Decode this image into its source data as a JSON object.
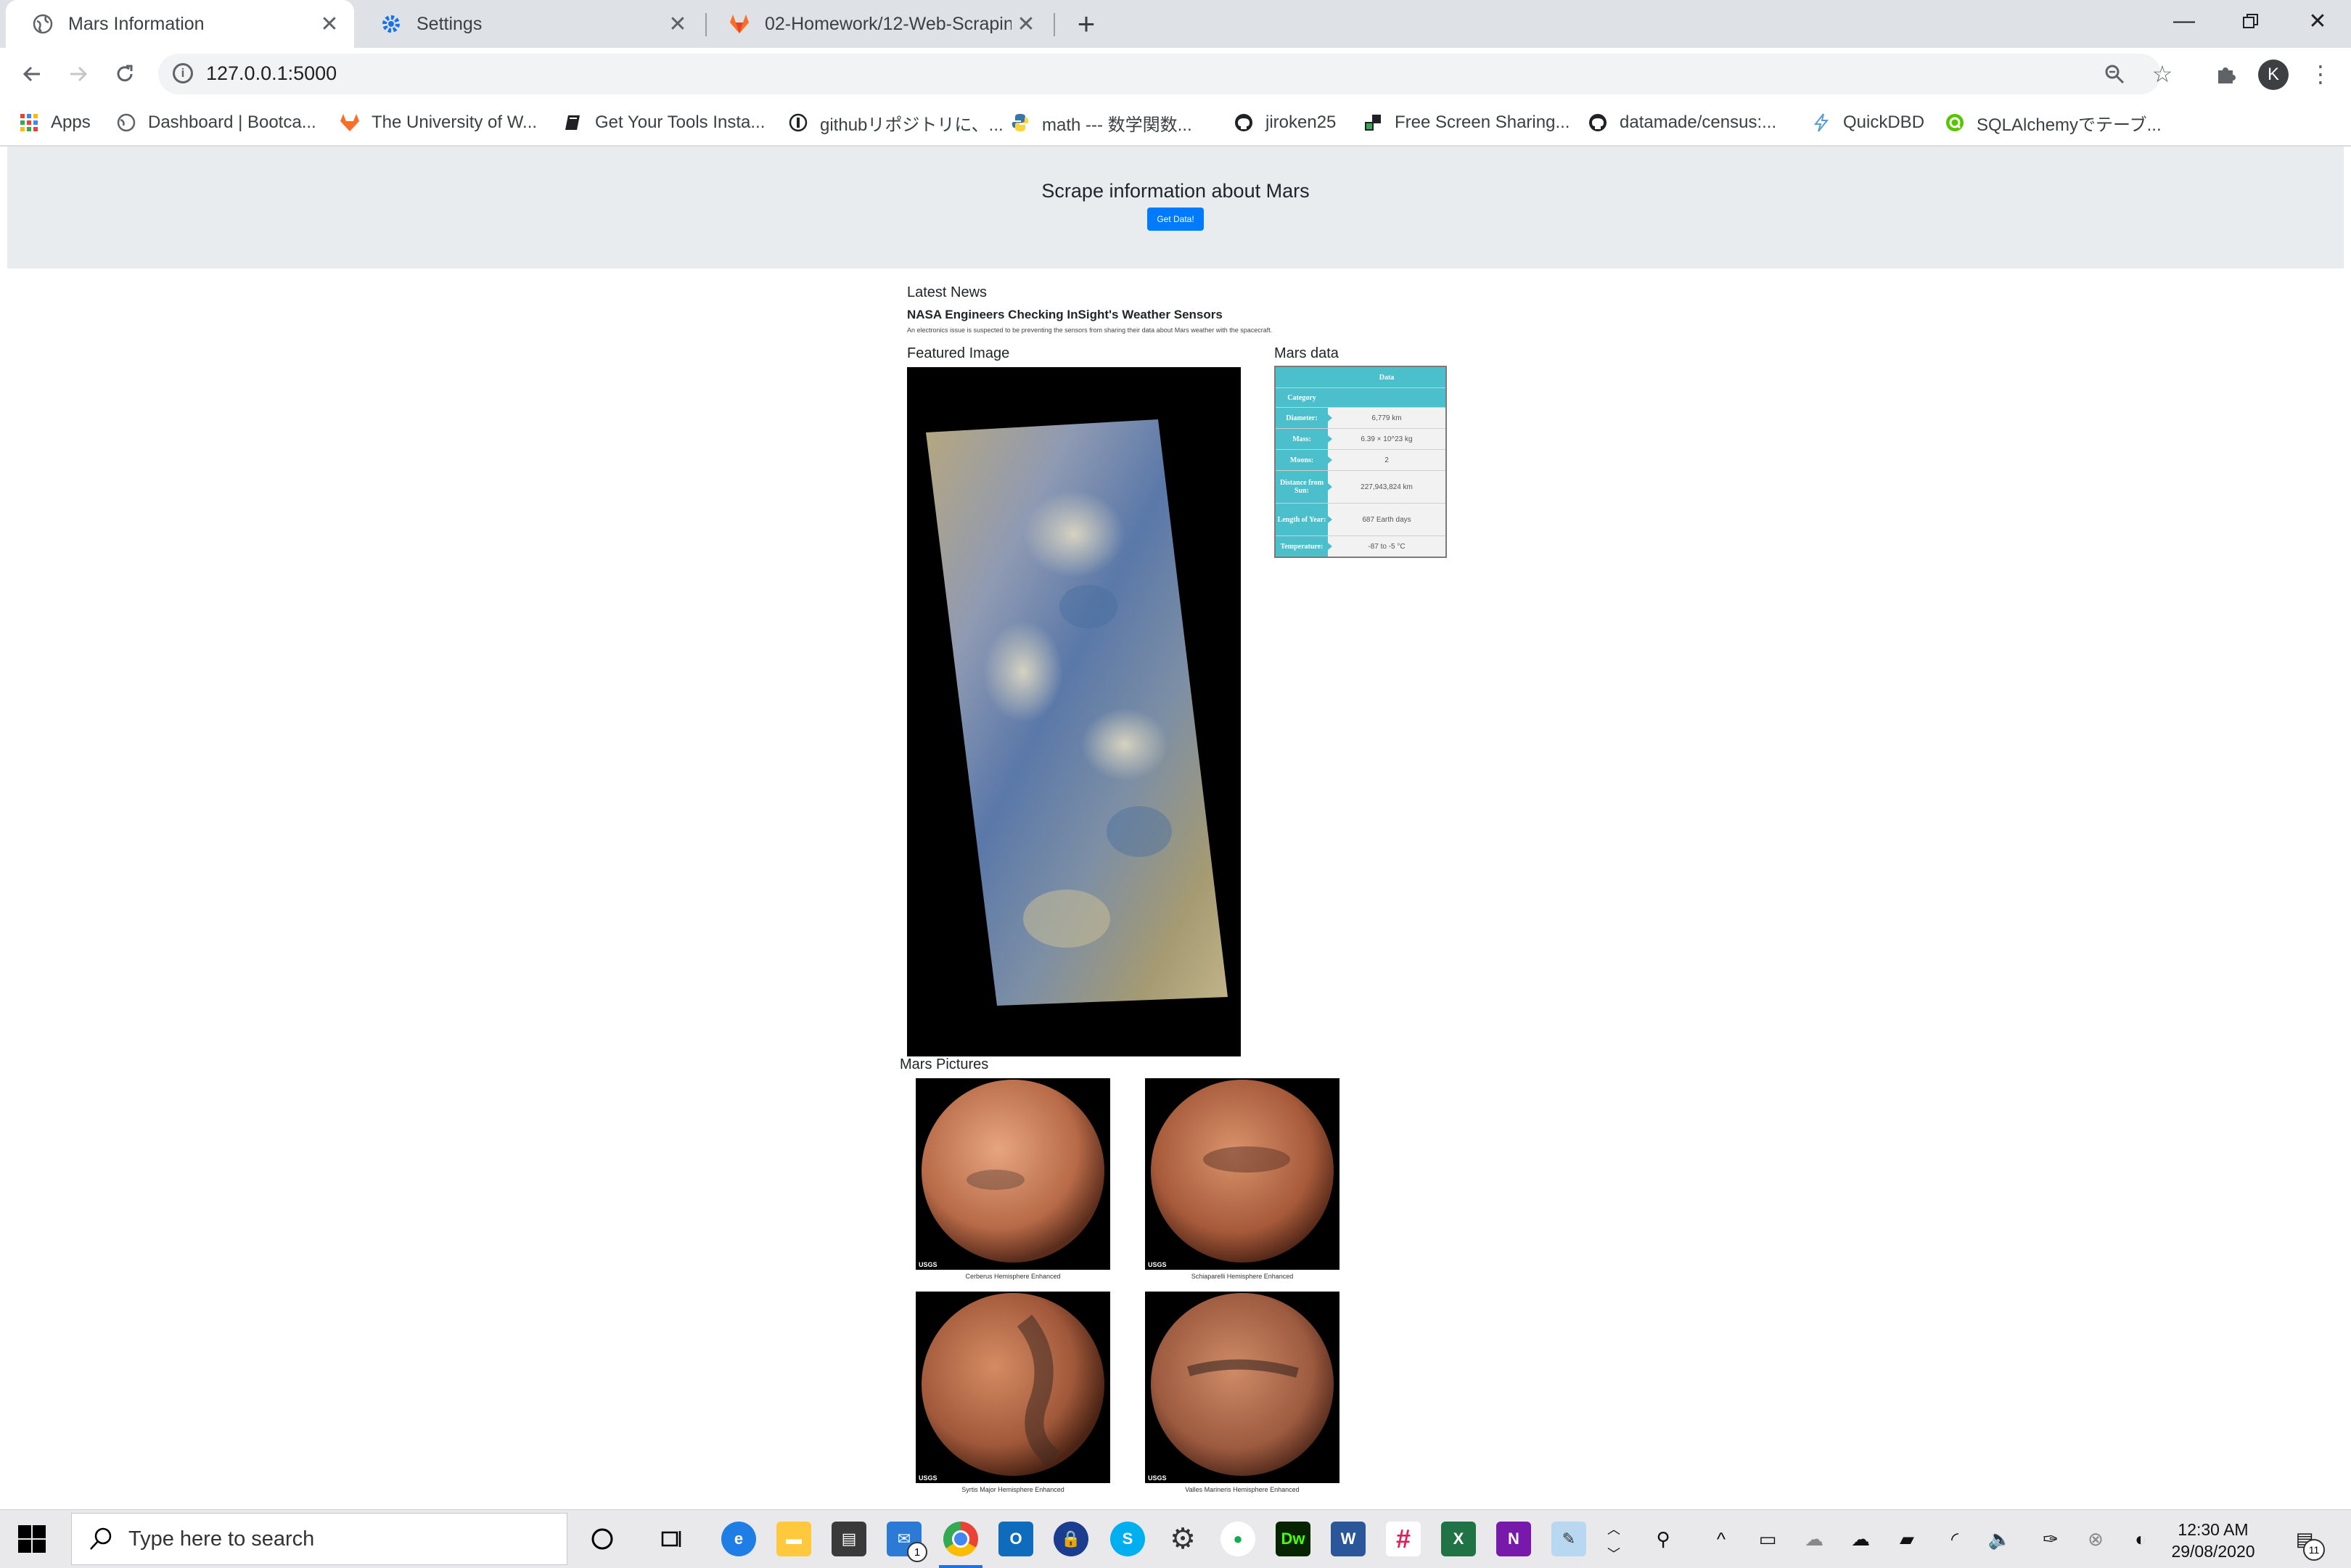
{
  "browser": {
    "tabs": [
      {
        "title": "Mars Information",
        "active": true
      },
      {
        "title": "Settings",
        "active": false
      },
      {
        "title": "02-Homework/12-Web-Scraping",
        "active": false
      }
    ],
    "url": "127.0.0.1:5000",
    "profile_initial": "K",
    "bookmarks": [
      {
        "label": "Apps",
        "icon": "apps-grid-icon"
      },
      {
        "label": "Dashboard | Bootca...",
        "icon": "globe-icon"
      },
      {
        "label": "The University of W...",
        "icon": "gitlab-icon"
      },
      {
        "label": "Get Your Tools Insta...",
        "icon": "book-icon"
      },
      {
        "label": "githubリポジトリに、...",
        "icon": "circle-icon"
      },
      {
        "label": "math --- 数学関数...",
        "icon": "python-icon"
      },
      {
        "label": "jiroken25",
        "icon": "github-icon"
      },
      {
        "label": "Free Screen Sharing...",
        "icon": "screenshare-icon"
      },
      {
        "label": "datamade/census:...",
        "icon": "github-icon"
      },
      {
        "label": "QuickDBD",
        "icon": "bolt-icon"
      },
      {
        "label": "SQLAlchemyでテーブ...",
        "icon": "qiita-icon"
      }
    ]
  },
  "page": {
    "jumbotron_title": "Scrape information about Mars",
    "get_data_label": "Get Data!",
    "latest_news_heading": "Latest News",
    "news_title": "NASA Engineers Checking InSight's Weather Sensors",
    "news_paragraph": "An electronics issue is suspected to be preventing the sensors from sharing their data about Mars weather with the spacecraft.",
    "featured_heading": "Featured Image",
    "facts_heading": "Mars data",
    "facts_header": {
      "key": "Category",
      "value": "Data"
    },
    "facts": [
      {
        "key": "Diameter:",
        "value": "6,779 km"
      },
      {
        "key": "Mass:",
        "value": "6.39 × 10^23 kg"
      },
      {
        "key": "Moons:",
        "value": "2"
      },
      {
        "key": "Distance from Sun:",
        "value": "227,943,824 km"
      },
      {
        "key": "Length of Year:",
        "value": "687 Earth days"
      },
      {
        "key": "Temperature:",
        "value": "-87 to -5 °C"
      }
    ],
    "pictures_heading": "Mars Pictures",
    "hemispheres": [
      {
        "caption": "Cerberus Hemisphere Enhanced"
      },
      {
        "caption": "Schiaparelli Hemisphere Enhanced"
      },
      {
        "caption": "Syrtis Major Hemisphere Enhanced"
      },
      {
        "caption": "Valles Marineris Hemisphere Enhanced"
      }
    ],
    "usgs_label": "USGS"
  },
  "taskbar": {
    "search_placeholder": "Type here to search",
    "time": "12:30 AM",
    "date": "29/08/2020",
    "mail_badge": "1",
    "notification_badge": "11"
  },
  "colors": {
    "accent_blue": "#007bff",
    "table_teal": "#4cbfcc",
    "jumbotron_bg": "#e9ecef"
  }
}
